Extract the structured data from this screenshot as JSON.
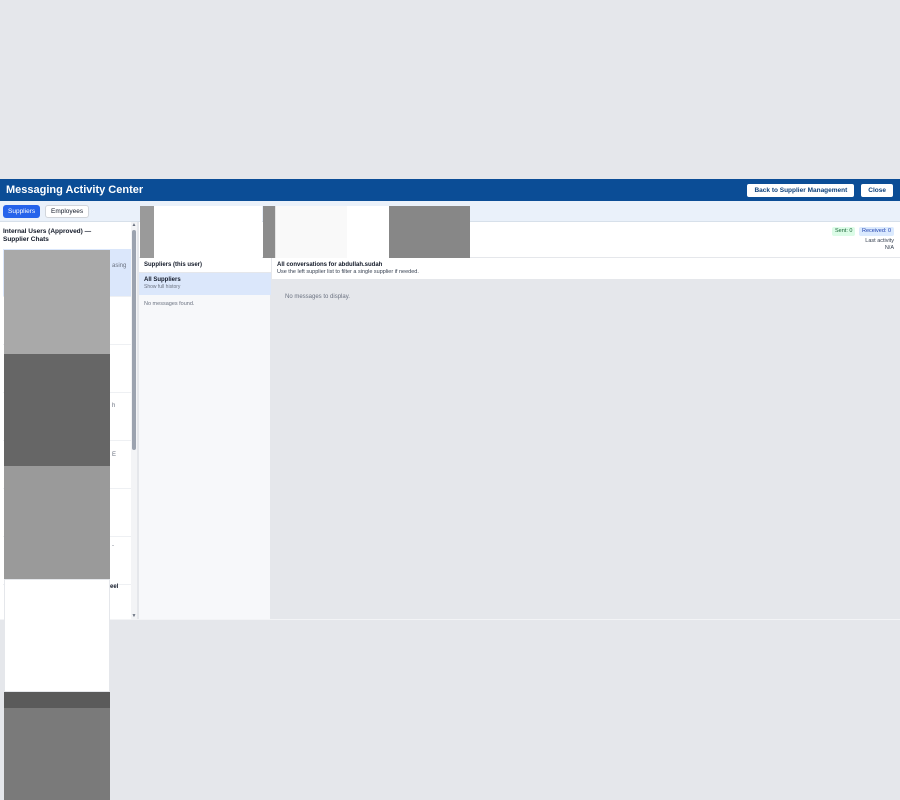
{
  "header": {
    "title": "Messaging Activity Center",
    "back_label": "Back to Supplier Management",
    "close_label": "Close"
  },
  "tabs": [
    {
      "label": "Suppliers",
      "active": true
    },
    {
      "label": "Employees",
      "active": false
    }
  ],
  "left_panel": {
    "title": "Internal Users (Approved) — Supplier Chats",
    "fragments": [
      "asing",
      "h",
      "E",
      "-",
      "eel"
    ]
  },
  "stats": {
    "sent": "Sent: 0",
    "received": "Received: 0",
    "last_activity_label": "Last activity",
    "last_activity_value": "N/A"
  },
  "suppliers": {
    "header": "Suppliers (this user)",
    "all_label": "All Suppliers",
    "all_sub": "Show full history",
    "empty": "No messages found."
  },
  "conversation": {
    "title": "All conversations for abdullah.sudah",
    "subtitle": "Use the left supplier list to filter a single supplier if needed.",
    "empty": "No messages to display."
  },
  "colors": {
    "header_bg": "#0b4d96",
    "accent": "#2563eb",
    "active_row": "#dbe7fb"
  }
}
